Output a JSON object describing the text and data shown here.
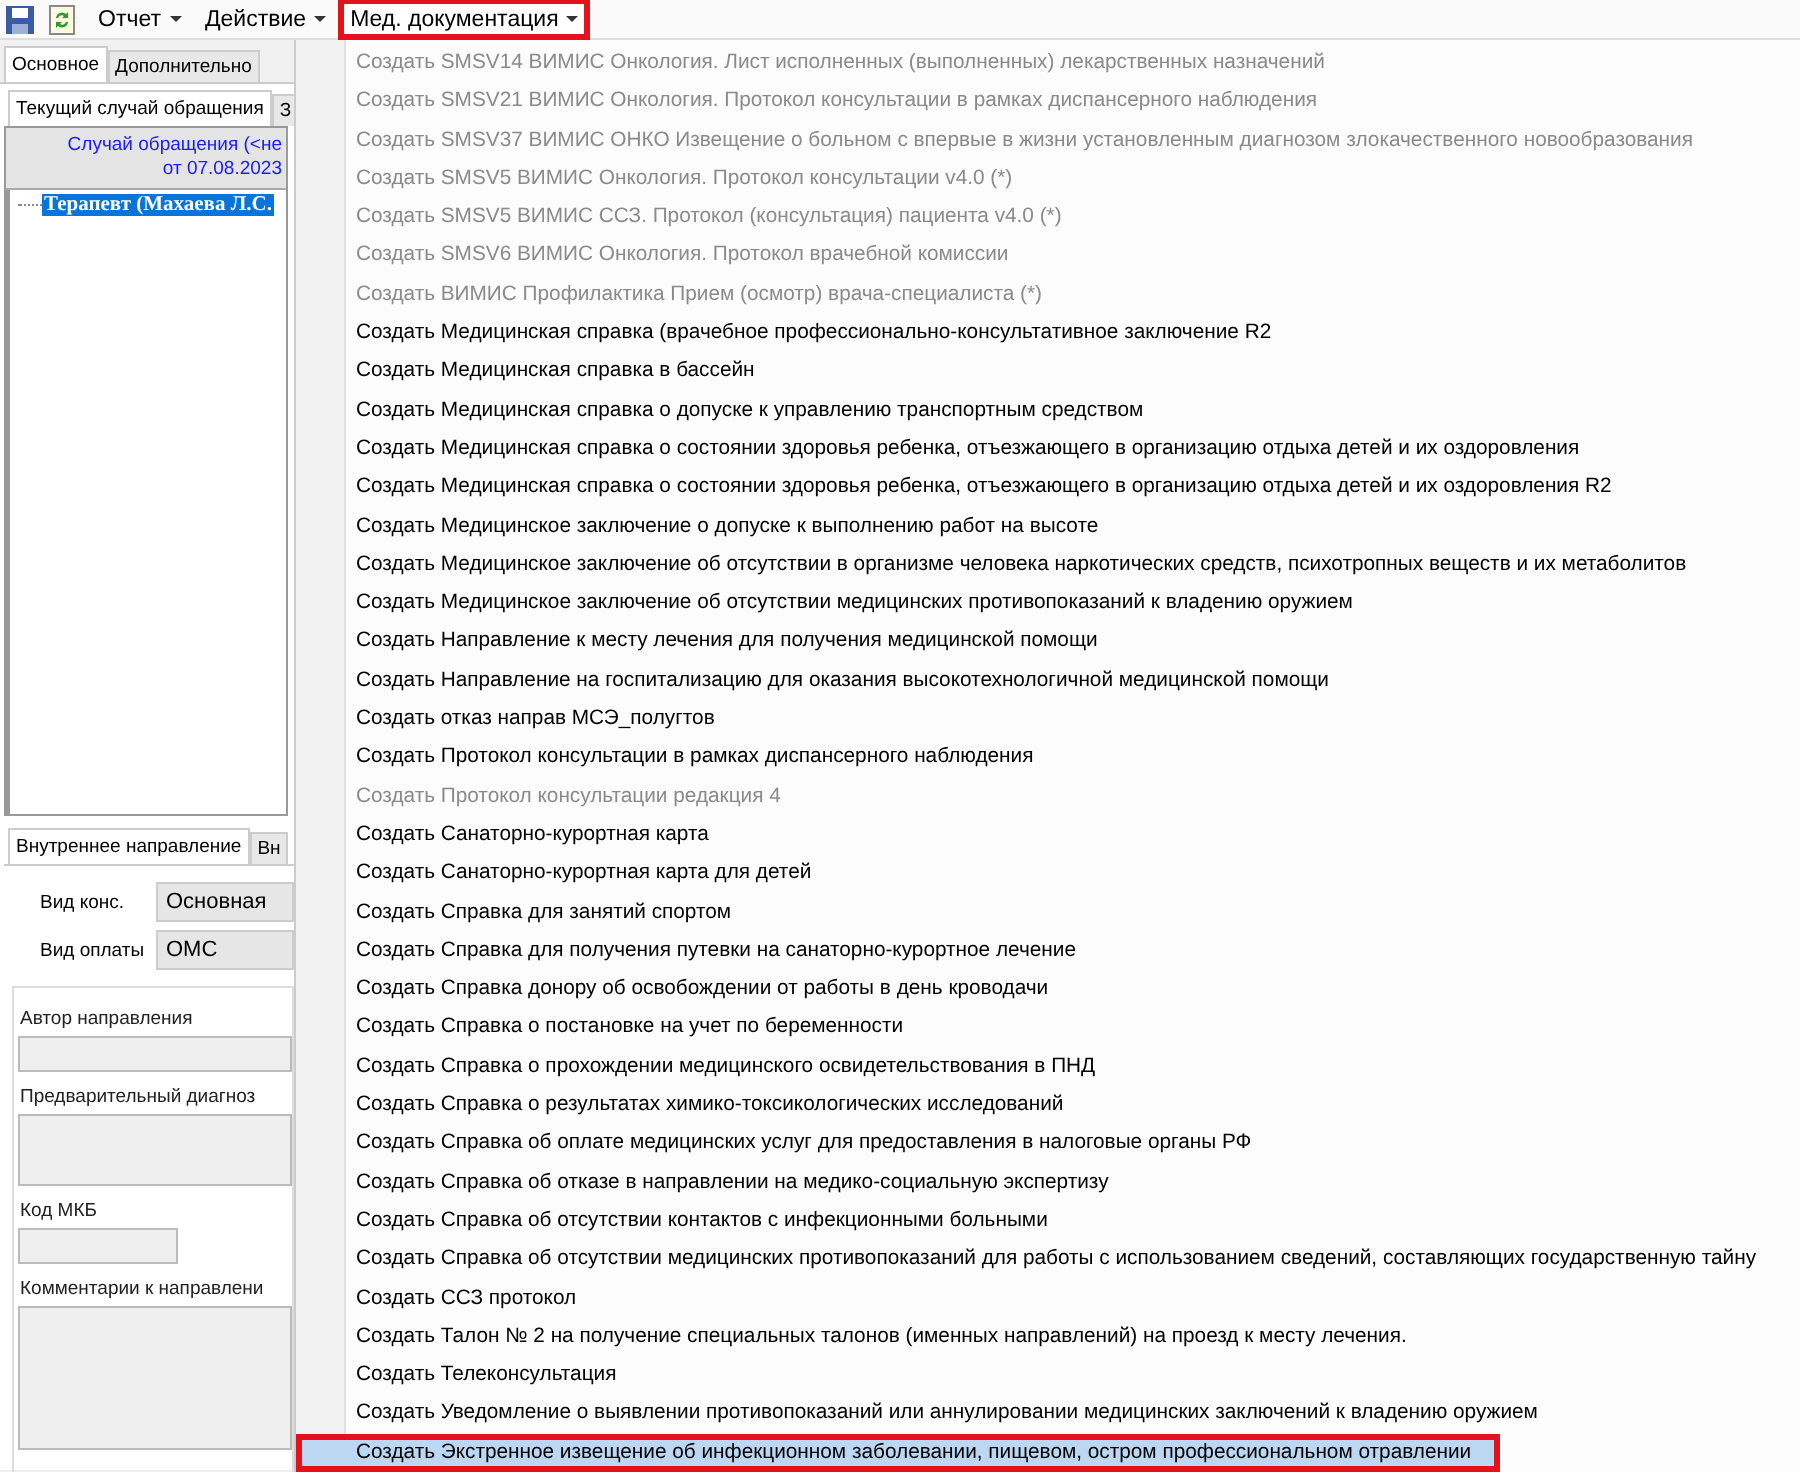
{
  "toolbar": {
    "menus": [
      {
        "label": "Отчет",
        "open": false,
        "annotated": false
      },
      {
        "label": "Действие",
        "open": false,
        "annotated": false
      },
      {
        "label": "Мед. документация",
        "open": true,
        "annotated": true
      }
    ]
  },
  "main_tabs": [
    {
      "label": "Основное",
      "selected": true
    },
    {
      "label": "Дополнительно",
      "selected": false
    }
  ],
  "case_tabs": [
    {
      "label": "Текущий случай обращения",
      "selected": true
    },
    {
      "label": "З",
      "selected": false
    }
  ],
  "case_header": {
    "title": "Случай обращения (<не",
    "date": "от 07.08.2023"
  },
  "tree": [
    {
      "label": "Терапевт (Махаева Л.С.",
      "selected": true
    }
  ],
  "referral_tabs": [
    {
      "label": "Внутреннее направление",
      "selected": true
    },
    {
      "label": "Вн",
      "selected": false
    }
  ],
  "referral": {
    "fields": [
      {
        "label": "Вид конс.",
        "value": "Основная"
      },
      {
        "label": "Вид оплаты",
        "value": "ОМС"
      }
    ],
    "group": [
      {
        "label": "Автор направления",
        "kind": "line"
      },
      {
        "label": "Предварительный диагноз",
        "kind": "area"
      },
      {
        "label": "Код МКБ",
        "kind": "short"
      },
      {
        "label": "Комментарии к направлени",
        "kind": "bigarea"
      }
    ]
  },
  "dropdown_menu": [
    {
      "label": "Создать SMSV14 ВИМИС  Онкология. Лист исполненных (выполненных) лекарственных назначений",
      "disabled": true,
      "selected": false,
      "annotated": false
    },
    {
      "label": "Создать SMSV21 ВИМИС Онкология. Протокол консультации в рамках диспансерного наблюдения",
      "disabled": true,
      "selected": false,
      "annotated": false
    },
    {
      "label": "Создать SMSV37 ВИМИС ОНКО Извещение о больном с впервые в жизни установленным диагнозом злокачественного новообразования",
      "disabled": true,
      "selected": false,
      "annotated": false
    },
    {
      "label": "Создать SMSV5 ВИМИС Онкология. Протокол консультации v4.0 (*)",
      "disabled": true,
      "selected": false,
      "annotated": false
    },
    {
      "label": "Создать SMSV5 ВИМИС ССЗ. Протокол (консультация) пациента v4.0 (*)",
      "disabled": true,
      "selected": false,
      "annotated": false
    },
    {
      "label": "Создать SMSV6 ВИМИС Онкология. Протокол врачебной комиссии",
      "disabled": true,
      "selected": false,
      "annotated": false
    },
    {
      "label": "Создать ВИМИС Профилактика Прием (осмотр) врача-специалиста (*)",
      "disabled": true,
      "selected": false,
      "annotated": false
    },
    {
      "label": "Создать Медицинская справка (врачебное профессионально-консультативное заключение R2",
      "disabled": false,
      "selected": false,
      "annotated": false
    },
    {
      "label": "Создать Медицинская справка в бассейн",
      "disabled": false,
      "selected": false,
      "annotated": false
    },
    {
      "label": "Создать Медицинская справка о допуске к управлению транспортным средством",
      "disabled": false,
      "selected": false,
      "annotated": false
    },
    {
      "label": "Создать Медицинская справка о состоянии здоровья ребенка, отъезжающего в организацию отдыха детей и их оздоровления",
      "disabled": false,
      "selected": false,
      "annotated": false
    },
    {
      "label": "Создать Медицинская справка о состоянии здоровья ребенка, отъезжающего в организацию отдыха детей и их оздоровления R2",
      "disabled": false,
      "selected": false,
      "annotated": false
    },
    {
      "label": "Создать Медицинское заключение о допуске к выполнению работ на высоте",
      "disabled": false,
      "selected": false,
      "annotated": false
    },
    {
      "label": "Создать Медицинское заключение об отсутствии в организме человека наркотических средств, психотропных веществ и их метаболитов",
      "disabled": false,
      "selected": false,
      "annotated": false
    },
    {
      "label": "Создать Медицинское заключение об отсутствии медицинских противопоказаний к владению оружием",
      "disabled": false,
      "selected": false,
      "annotated": false
    },
    {
      "label": "Создать Направление к месту лечения для получения медицинской помощи",
      "disabled": false,
      "selected": false,
      "annotated": false
    },
    {
      "label": "Создать Направление на госпитализацию для оказания высокотехнологичной медицинской помощи",
      "disabled": false,
      "selected": false,
      "annotated": false
    },
    {
      "label": "Создать отказ направ МСЭ_полугтов",
      "disabled": false,
      "selected": false,
      "annotated": false
    },
    {
      "label": "Создать Протокол консультации в рамках диспансерного наблюдения",
      "disabled": false,
      "selected": false,
      "annotated": false
    },
    {
      "label": "Создать Протокол консультации редакция 4",
      "disabled": true,
      "selected": false,
      "annotated": false
    },
    {
      "label": "Создать Санаторно-курортная карта",
      "disabled": false,
      "selected": false,
      "annotated": false
    },
    {
      "label": "Создать Санаторно-курортная карта для детей",
      "disabled": false,
      "selected": false,
      "annotated": false
    },
    {
      "label": "Создать Справка для занятий спортом",
      "disabled": false,
      "selected": false,
      "annotated": false
    },
    {
      "label": "Создать Справка для получения путевки на санаторно-курортное лечение",
      "disabled": false,
      "selected": false,
      "annotated": false
    },
    {
      "label": "Создать Справка донору об освобождении от работы в день кроводачи",
      "disabled": false,
      "selected": false,
      "annotated": false
    },
    {
      "label": "Создать Справка о постановке на учет по беременности",
      "disabled": false,
      "selected": false,
      "annotated": false
    },
    {
      "label": "Создать Справка о прохождении медицинского освидетельствования в ПНД",
      "disabled": false,
      "selected": false,
      "annotated": false
    },
    {
      "label": "Создать Справка о результатах химико-токсикологических исследований",
      "disabled": false,
      "selected": false,
      "annotated": false
    },
    {
      "label": "Создать Справка об оплате медицинских услуг для предоставления в налоговые органы РФ",
      "disabled": false,
      "selected": false,
      "annotated": false
    },
    {
      "label": "Создать Справка об отказе в направлении на медико-социальную экспертизу",
      "disabled": false,
      "selected": false,
      "annotated": false
    },
    {
      "label": "Создать Справка об отсутствии контактов с инфекционными больными",
      "disabled": false,
      "selected": false,
      "annotated": false
    },
    {
      "label": "Создать Справка об отсутствии медицинских противопоказаний для работы с использованием сведений, составляющих государственную тайну",
      "disabled": false,
      "selected": false,
      "annotated": false
    },
    {
      "label": "Создать ССЗ протокол",
      "disabled": false,
      "selected": false,
      "annotated": false
    },
    {
      "label": "Создать Талон № 2 на получение специальных талонов (именных направлений) на проезд к месту лечения.",
      "disabled": false,
      "selected": false,
      "annotated": false
    },
    {
      "label": "Создать Телеконсультация",
      "disabled": false,
      "selected": false,
      "annotated": false
    },
    {
      "label": "Создать Уведомление о выявлении противопоказаний или аннулировании медицинских заключений к владению оружием",
      "disabled": false,
      "selected": false,
      "annotated": false
    },
    {
      "label": "Создать Экстренное извещение об инфекционном заболевании, пищевом, остром профессиональном отравлении",
      "disabled": false,
      "selected": true,
      "annotated": true
    }
  ]
}
